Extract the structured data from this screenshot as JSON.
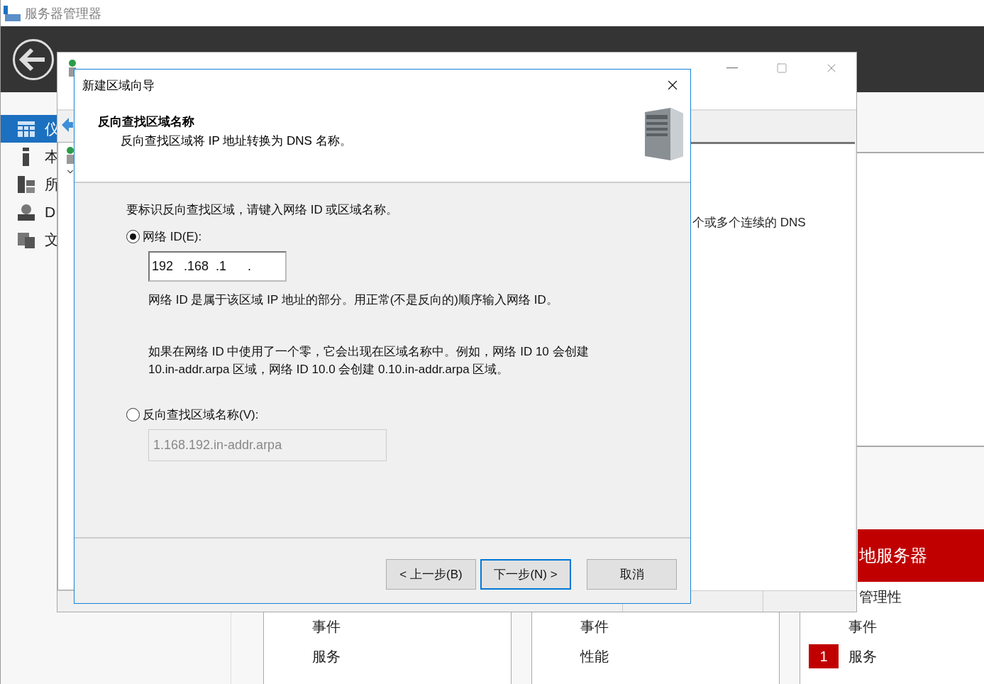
{
  "app": {
    "title": "服务器管理器"
  },
  "sidebar": {
    "items": [
      {
        "label": "仪",
        "selected": true,
        "kind": "dashboard"
      },
      {
        "label": "本",
        "selected": false,
        "kind": "local"
      },
      {
        "label": "所",
        "selected": false,
        "kind": "all"
      },
      {
        "label": "D",
        "selected": false,
        "kind": "dns"
      },
      {
        "label": "文",
        "selected": false,
        "kind": "files"
      }
    ]
  },
  "tiles": [
    {
      "rows": [
        {
          "label": "事件"
        },
        {
          "label": "服务"
        }
      ]
    },
    {
      "rows": [
        {
          "label": "事件"
        },
        {
          "label": "性能"
        }
      ]
    },
    {
      "title": "地服务器",
      "rows": [
        {
          "label": "管理性"
        },
        {
          "label": "事件"
        },
        {
          "label": "服务",
          "badge": "1"
        }
      ]
    }
  ],
  "dns_manager": {
    "detail_text": "个或多个连续的 DNS"
  },
  "wizard": {
    "title": "新建区域向导",
    "heading": "反向查找区域名称",
    "subtitle": "反向查找区域将 IP 地址转换为 DNS 名称。",
    "instruction": "要标识反向查找区域，请键入网络 ID 或区域名称。",
    "options": [
      {
        "kind": "network_id",
        "label": "网络 ID(E):",
        "selected": true,
        "ip_segments": [
          "192",
          ".168",
          ".1",
          "."
        ],
        "help": [
          "网络 ID 是属于该区域 IP 地址的部分。用正常(不是反向的)顺序输入网络 ID。"
        ],
        "notes": [
          "如果在网络 ID 中使用了一个零，它会出现在区域名称中。例如，网络 ID 10 会创建",
          "10.in-addr.arpa 区域，网络 ID 10.0 会创建 0.10.in-addr.arpa 区域。"
        ]
      },
      {
        "kind": "zone_name",
        "label": "反向查找区域名称(V):",
        "selected": false,
        "value": "1.168.192.in-addr.arpa",
        "disabled": true
      }
    ],
    "buttons": [
      {
        "label": "< 上一步(B)",
        "focused": false
      },
      {
        "label": "下一步(N) >",
        "focused": true
      },
      {
        "label": "取消",
        "focused": false
      }
    ]
  }
}
